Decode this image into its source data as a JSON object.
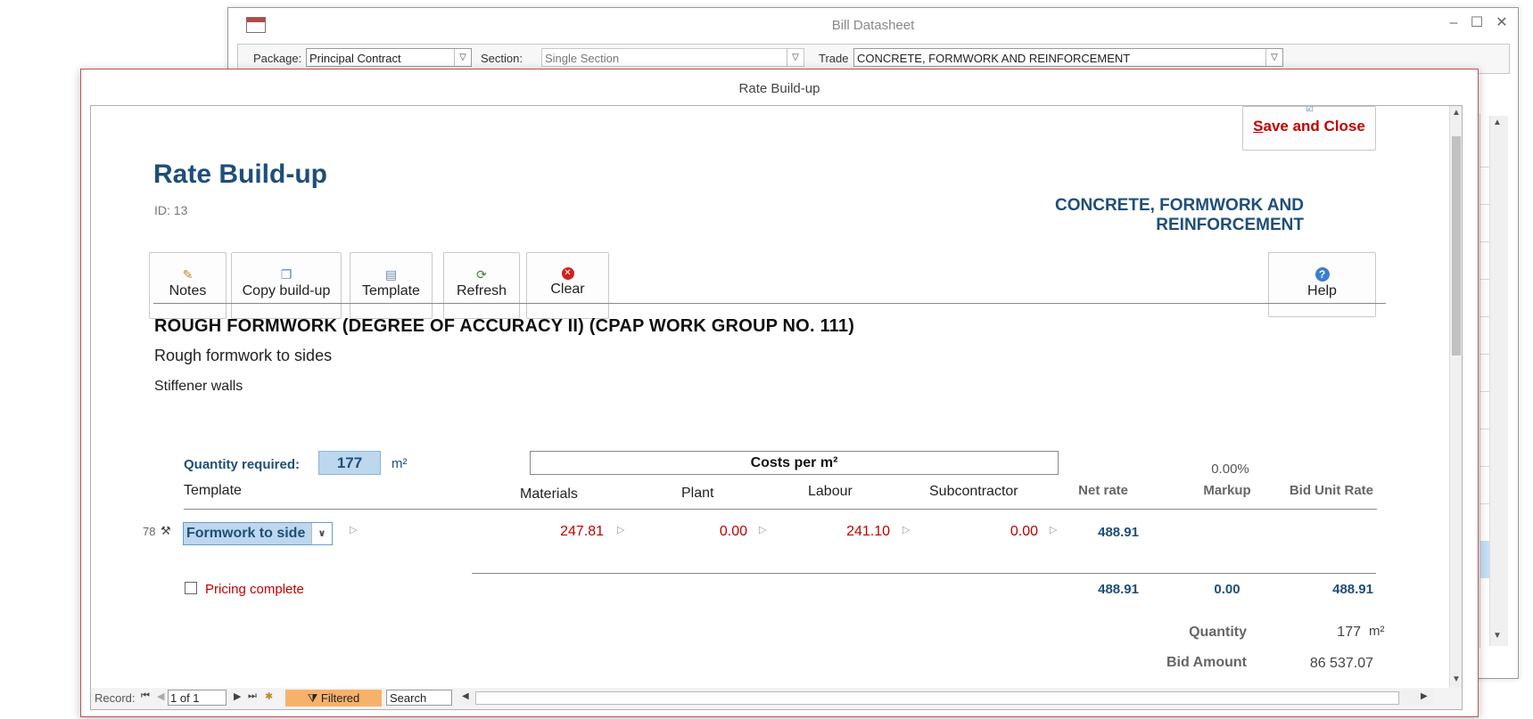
{
  "bill_window": {
    "title": "Bill Datasheet",
    "package_label": "Package:",
    "package_value": "Principal Contract",
    "section_label": "Section:",
    "section_value": "Single Section",
    "trade_label": "Trade",
    "trade_value": "CONCRETE, FORMWORK AND REINFORCEMENT"
  },
  "window": {
    "title": "Rate Build-up",
    "save_close_label_first": "S",
    "save_close_label_rest": "ave and Close"
  },
  "form": {
    "title": "Rate Build-up",
    "id_text": "ID: 13",
    "trade_heading": "CONCRETE, FORMWORK AND REINFORCEMENT"
  },
  "toolbar": {
    "notes": "Notes",
    "copy": "Copy build-up",
    "template": "Template",
    "refresh": "Refresh",
    "clear": "Clear",
    "help": "Help"
  },
  "item": {
    "heading": "ROUGH FORMWORK (DEGREE OF ACCURACY II) (CPAP WORK GROUP NO. 111)",
    "desc1": "Rough formwork to sides",
    "desc2": "Stiffener walls"
  },
  "quantity": {
    "label": "Quantity required:",
    "value": "177",
    "unit": "m²"
  },
  "columns": {
    "costs_header": "Costs per m²",
    "markup_pct": "0.00%",
    "template": "Template",
    "materials": "Materials",
    "plant": "Plant",
    "labour": "Labour",
    "subcontractor": "Subcontractor",
    "net_rate": "Net rate",
    "markup": "Markup",
    "bid_unit_rate": "Bid Unit Rate"
  },
  "row": {
    "number": "78",
    "template": "Formwork to side",
    "materials": "247.81",
    "plant": "0.00",
    "labour": "241.10",
    "subcontractor": "0.00",
    "net_rate": "488.91"
  },
  "summary": {
    "pricing_complete_label": "Pricing complete",
    "pricing_complete_checked": false,
    "net_rate_total": "488.91",
    "markup_total": "0.00",
    "bid_unit_rate_total": "488.91",
    "quantity_label": "Quantity",
    "quantity_value": "177",
    "quantity_unit": "m²",
    "bid_amount_label": "Bid Amount",
    "bid_amount_value": "86 537.07"
  },
  "statusbar": {
    "record_label": "Record:",
    "record_value": "1 of 1",
    "filtered": "Filtered",
    "search": "Search"
  }
}
